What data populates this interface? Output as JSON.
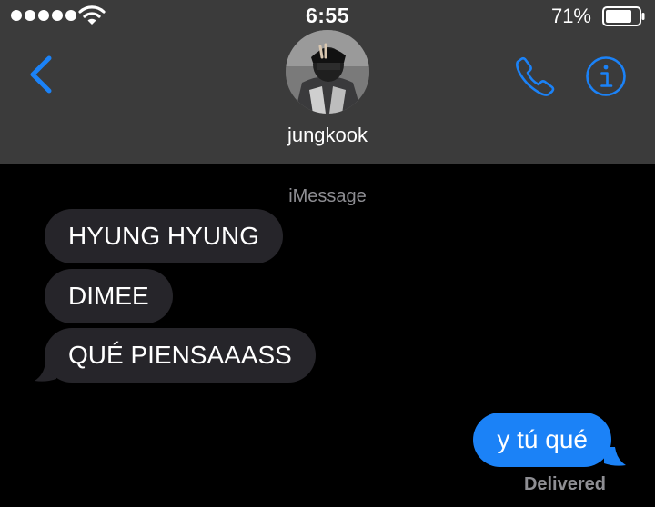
{
  "status_bar": {
    "time": "6:55",
    "battery_percent": "71%",
    "battery_level": 0.71,
    "signal_bars": 5,
    "wifi_icon": "wifi-icon"
  },
  "header": {
    "contact_name": "jungkook",
    "back_icon": "chevron-left-icon",
    "call_icon": "phone-icon",
    "info_icon": "info-icon",
    "accent_color": "#1b82f7"
  },
  "conversation": {
    "service": "iMessage",
    "messages": [
      {
        "from": "contact",
        "text": "HYUNG HYUNG"
      },
      {
        "from": "contact",
        "text": "DIMEE"
      },
      {
        "from": "contact",
        "text": "QUÉ PIENSAAASS"
      },
      {
        "from": "me",
        "text": "y tú qué"
      }
    ],
    "delivery_status": "Delivered",
    "incoming_bubble_color": "#26252a",
    "outgoing_bubble_color": "#1b82f7"
  }
}
